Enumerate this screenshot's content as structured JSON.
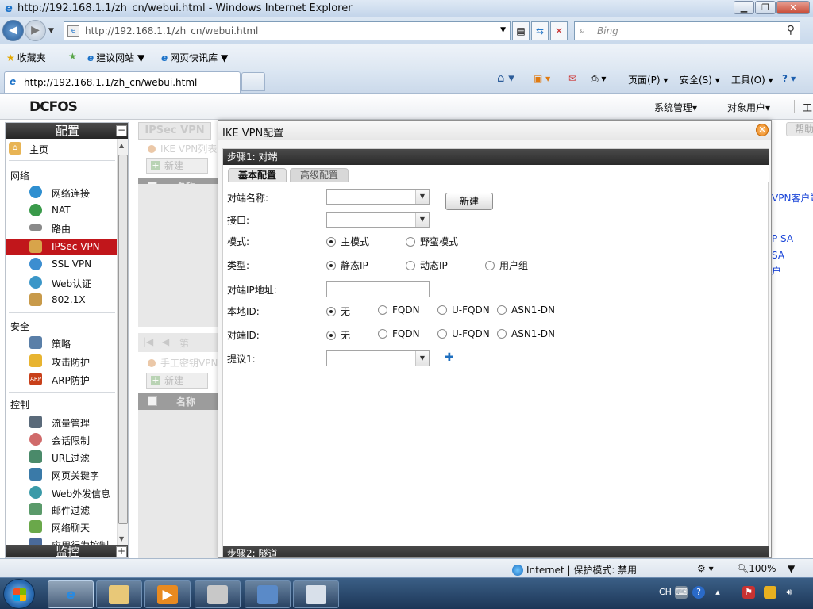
{
  "window": {
    "title": "http://192.168.1.1/zh_cn/webui.html - Windows Internet Explorer",
    "min_label": "▁",
    "max_label": "❐",
    "close_label": "✕"
  },
  "address": {
    "url": "http://192.168.1.1/zh_cn/webui.html",
    "search_placeholder": "Bing"
  },
  "favorites": {
    "favorites_label": "收藏夹",
    "suggested_sites": "建议网站",
    "web_slice": "网页快讯库"
  },
  "tab": {
    "title": "http://192.168.1.1/zh_cn/webui.html"
  },
  "commandbar": {
    "page": "页面(P)",
    "safety": "安全(S)",
    "tools": "工具(O)"
  },
  "app": {
    "logo": "DCFOS",
    "menu_system": "系统管理",
    "menu_objects": "对象用户",
    "menu_partial": "工"
  },
  "sidebar": {
    "header": "配置",
    "footer": "监控",
    "home": "主页",
    "groups": {
      "network": "网络",
      "security": "安全",
      "control": "控制"
    },
    "network_items": [
      "网络连接",
      "NAT",
      "路由",
      "IPSec VPN",
      "SSL VPN",
      "Web认证",
      "802.1X"
    ],
    "security_items": [
      "策略",
      "攻击防护",
      "ARP防护"
    ],
    "control_items": [
      "流量管理",
      "会话限制",
      "URL过滤",
      "网页关键字",
      "Web外发信息",
      "邮件过滤",
      "网络聊天",
      "应用行为控制"
    ]
  },
  "background": {
    "tab": "IPSec VPN",
    "ike_list": "IKE VPN列表",
    "new_button": "新建",
    "name_col": "名称",
    "page_label": "第",
    "manual_list": "手工密钥VPN",
    "help": "帮助",
    "right_links": [
      "VPN客户端",
      "P SA",
      "SA",
      "户"
    ]
  },
  "modal": {
    "title": "IKE VPN配置",
    "step1": "步骤1: 对端",
    "step2": "步骤2: 隧道",
    "tab_basic": "基本配置",
    "tab_advanced": "高级配置",
    "peer_name_label": "对端名称:",
    "new_button": "新建",
    "interface_label": "接口:",
    "mode_label": "模式:",
    "mode_main": "主模式",
    "mode_aggressive": "野蛮模式",
    "type_label": "类型:",
    "type_static": "静态IP",
    "type_dynamic": "动态IP",
    "type_usergroup": "用户组",
    "peer_ip_label": "对端IP地址:",
    "peer_ip_value": "",
    "local_id_label": "本地ID:",
    "peer_id_label": "对端ID:",
    "id_none": "无",
    "id_fqdn": "FQDN",
    "id_ufqdn": "U-FQDN",
    "id_asn1": "ASN1-DN",
    "proposal_label": "提议1:"
  },
  "statusbar": {
    "zone": "Internet | 保护模式: 禁用",
    "zoom": "100%"
  },
  "taskbar": {
    "lang": "CH"
  }
}
